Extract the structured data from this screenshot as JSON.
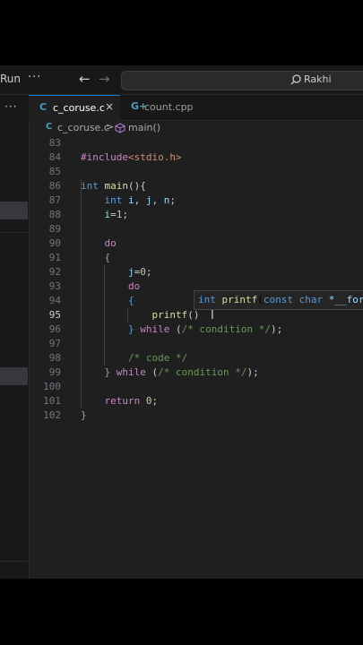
{
  "titlebar": {
    "run_label": "Run",
    "more": "···",
    "back": "←",
    "forward": "→",
    "search_text": "Rakhi"
  },
  "sidebar": {
    "more": "···"
  },
  "tabs": [
    {
      "icon": "C",
      "label": "c_coruse.c",
      "close": "×",
      "icon_color": "#519aba"
    },
    {
      "icon": "G+",
      "label": "count.cpp",
      "icon_color": "#519aba"
    }
  ],
  "breadcrumb": {
    "icon": "C",
    "file": "c_coruse.c",
    "separator": ">",
    "symbol": "main()"
  },
  "editor": {
    "current_line": 95,
    "lines": [
      {
        "n": "83",
        "tokens": []
      },
      {
        "n": "84",
        "tokens": [
          [
            "pp",
            "#include"
          ],
          [
            "str",
            "<stdio.h>"
          ]
        ]
      },
      {
        "n": "85",
        "tokens": []
      },
      {
        "n": "86",
        "tokens": [
          [
            "kw",
            "int"
          ],
          [
            "plain",
            " "
          ],
          [
            "fn",
            "main"
          ],
          [
            "plain",
            "(){"
          ]
        ]
      },
      {
        "n": "87",
        "tokens": [
          [
            "plain",
            "    "
          ],
          [
            "kw",
            "int"
          ],
          [
            "plain",
            " "
          ],
          [
            "var",
            "i"
          ],
          [
            "plain",
            ", "
          ],
          [
            "var",
            "j"
          ],
          [
            "plain",
            ", "
          ],
          [
            "var",
            "n"
          ],
          [
            "plain",
            ";"
          ]
        ]
      },
      {
        "n": "88",
        "tokens": [
          [
            "plain",
            "    "
          ],
          [
            "var",
            "i"
          ],
          [
            "plain",
            "="
          ],
          [
            "num",
            "1"
          ],
          [
            "plain",
            ";"
          ]
        ]
      },
      {
        "n": "89",
        "tokens": []
      },
      {
        "n": "90",
        "tokens": [
          [
            "plain",
            "    "
          ],
          [
            "ctl",
            "do"
          ]
        ]
      },
      {
        "n": "91",
        "tokens": [
          [
            "plain",
            "    "
          ],
          [
            "ctl",
            "{"
          ]
        ]
      },
      {
        "n": "92",
        "tokens": [
          [
            "plain",
            "        "
          ],
          [
            "var",
            "j"
          ],
          [
            "plain",
            "="
          ],
          [
            "num",
            "0"
          ],
          [
            "plain",
            ";"
          ]
        ]
      },
      {
        "n": "93",
        "tokens": [
          [
            "plain",
            "        "
          ],
          [
            "ctl",
            "do"
          ]
        ]
      },
      {
        "n": "94",
        "tokens": [
          [
            "plain",
            "        "
          ],
          [
            "kw",
            "{"
          ]
        ]
      },
      {
        "n": "95",
        "tokens": [
          [
            "plain",
            "            "
          ],
          [
            "fn",
            "printf"
          ],
          [
            "plain",
            "()"
          ]
        ]
      },
      {
        "n": "96",
        "tokens": [
          [
            "plain",
            "        "
          ],
          [
            "kw",
            "}"
          ],
          [
            "plain",
            " "
          ],
          [
            "ctl",
            "while"
          ],
          [
            "plain",
            " ("
          ],
          [
            "cmt",
            "/* condition */"
          ],
          [
            "plain",
            ");"
          ]
        ]
      },
      {
        "n": "97",
        "tokens": []
      },
      {
        "n": "98",
        "tokens": [
          [
            "plain",
            "        "
          ],
          [
            "cmt",
            "/* code */"
          ]
        ]
      },
      {
        "n": "99",
        "tokens": [
          [
            "plain",
            "    "
          ],
          [
            "ctl",
            "}"
          ],
          [
            "plain",
            " "
          ],
          [
            "ctl",
            "while"
          ],
          [
            "plain",
            " ("
          ],
          [
            "cmt",
            "/* condition */"
          ],
          [
            "plain",
            ");"
          ]
        ]
      },
      {
        "n": "100",
        "tokens": []
      },
      {
        "n": "101",
        "tokens": [
          [
            "plain",
            "    "
          ],
          [
            "ctl",
            "return"
          ],
          [
            "plain",
            " "
          ],
          [
            "num",
            "0"
          ],
          [
            "plain",
            ";"
          ]
        ]
      },
      {
        "n": "102",
        "tokens": [
          [
            "plain",
            ""
          ],
          [
            "ctl",
            "}"
          ]
        ]
      }
    ]
  },
  "signature_help": {
    "tokens": [
      [
        "kw",
        "int"
      ],
      [
        "plain",
        " "
      ],
      [
        "fn",
        "printf"
      ],
      [
        "plain",
        "("
      ],
      [
        "kw",
        "const"
      ],
      [
        "plain",
        " "
      ],
      [
        "kw",
        "char"
      ],
      [
        "plain",
        " "
      ],
      [
        "var",
        "*__form"
      ]
    ]
  },
  "colors": {
    "accent": "#0078d4",
    "editor_bg": "#1f1f1f",
    "chrome_bg": "#181818"
  }
}
